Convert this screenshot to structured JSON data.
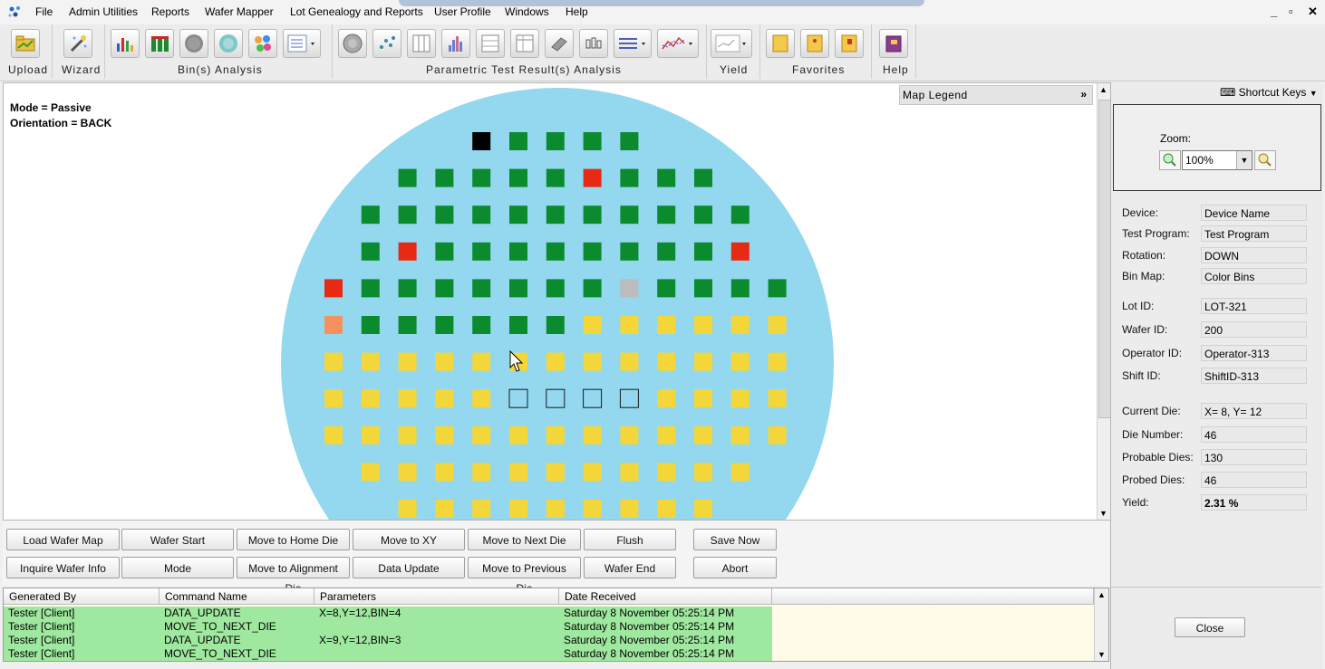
{
  "menu": [
    "File",
    "Admin Utilities",
    "Reports",
    "Wafer Mapper",
    "Lot Genealogy and Reports",
    "User Profile",
    "Windows",
    "Help"
  ],
  "window_controls": [
    "_",
    "▫",
    "✕"
  ],
  "toolbar_groups": [
    "Upload",
    "Wizard",
    "Bin(s) Analysis",
    "Parametric Test Result(s) Analysis",
    "Yield",
    "Favorites",
    "Help"
  ],
  "map": {
    "mode_text": "Mode = Passive",
    "orientation_text": "Orientation = BACK",
    "legend_label": "Map Legend"
  },
  "colors": {
    "wafer": "#93d8ee",
    "pass": "#0b8a2e",
    "fail": "#e62a14",
    "orange": "#f6905d",
    "yellow": "#f3d63a",
    "gray": "#bcbcbc",
    "black": "#000000",
    "log_row": "#9fe89f"
  },
  "dies": [
    {
      "x": 4,
      "y": 0,
      "status": "black"
    },
    {
      "x": 5,
      "y": 0,
      "status": "pass"
    },
    {
      "x": 6,
      "y": 0,
      "status": "pass"
    },
    {
      "x": 7,
      "y": 0,
      "status": "pass"
    },
    {
      "x": 8,
      "y": 0,
      "status": "pass"
    },
    {
      "x": 2,
      "y": 1,
      "status": "pass"
    },
    {
      "x": 3,
      "y": 1,
      "status": "pass"
    },
    {
      "x": 4,
      "y": 1,
      "status": "pass"
    },
    {
      "x": 5,
      "y": 1,
      "status": "pass"
    },
    {
      "x": 6,
      "y": 1,
      "status": "pass"
    },
    {
      "x": 7,
      "y": 1,
      "status": "fail"
    },
    {
      "x": 8,
      "y": 1,
      "status": "pass"
    },
    {
      "x": 9,
      "y": 1,
      "status": "pass"
    },
    {
      "x": 10,
      "y": 1,
      "status": "pass"
    },
    {
      "x": 1,
      "y": 2,
      "status": "pass"
    },
    {
      "x": 2,
      "y": 2,
      "status": "pass"
    },
    {
      "x": 3,
      "y": 2,
      "status": "pass"
    },
    {
      "x": 4,
      "y": 2,
      "status": "pass"
    },
    {
      "x": 5,
      "y": 2,
      "status": "pass"
    },
    {
      "x": 6,
      "y": 2,
      "status": "pass"
    },
    {
      "x": 7,
      "y": 2,
      "status": "pass"
    },
    {
      "x": 8,
      "y": 2,
      "status": "pass"
    },
    {
      "x": 9,
      "y": 2,
      "status": "pass"
    },
    {
      "x": 10,
      "y": 2,
      "status": "pass"
    },
    {
      "x": 11,
      "y": 2,
      "status": "pass"
    },
    {
      "x": 1,
      "y": 3,
      "status": "pass"
    },
    {
      "x": 2,
      "y": 3,
      "status": "fail"
    },
    {
      "x": 3,
      "y": 3,
      "status": "pass"
    },
    {
      "x": 4,
      "y": 3,
      "status": "pass"
    },
    {
      "x": 5,
      "y": 3,
      "status": "pass"
    },
    {
      "x": 6,
      "y": 3,
      "status": "pass"
    },
    {
      "x": 7,
      "y": 3,
      "status": "pass"
    },
    {
      "x": 8,
      "y": 3,
      "status": "pass"
    },
    {
      "x": 9,
      "y": 3,
      "status": "pass"
    },
    {
      "x": 10,
      "y": 3,
      "status": "pass"
    },
    {
      "x": 11,
      "y": 3,
      "status": "fail"
    },
    {
      "x": 0,
      "y": 4,
      "status": "fail"
    },
    {
      "x": 1,
      "y": 4,
      "status": "pass"
    },
    {
      "x": 2,
      "y": 4,
      "status": "pass"
    },
    {
      "x": 3,
      "y": 4,
      "status": "pass"
    },
    {
      "x": 4,
      "y": 4,
      "status": "pass"
    },
    {
      "x": 5,
      "y": 4,
      "status": "pass"
    },
    {
      "x": 6,
      "y": 4,
      "status": "pass"
    },
    {
      "x": 7,
      "y": 4,
      "status": "pass"
    },
    {
      "x": 8,
      "y": 4,
      "status": "gray"
    },
    {
      "x": 9,
      "y": 4,
      "status": "pass"
    },
    {
      "x": 10,
      "y": 4,
      "status": "pass"
    },
    {
      "x": 11,
      "y": 4,
      "status": "pass"
    },
    {
      "x": 12,
      "y": 4,
      "status": "pass"
    },
    {
      "x": 0,
      "y": 5,
      "status": "orange"
    },
    {
      "x": 1,
      "y": 5,
      "status": "pass"
    },
    {
      "x": 2,
      "y": 5,
      "status": "pass"
    },
    {
      "x": 3,
      "y": 5,
      "status": "pass"
    },
    {
      "x": 4,
      "y": 5,
      "status": "pass"
    },
    {
      "x": 5,
      "y": 5,
      "status": "pass"
    },
    {
      "x": 6,
      "y": 5,
      "status": "pass"
    },
    {
      "x": 7,
      "y": 5,
      "status": "yellow"
    },
    {
      "x": 8,
      "y": 5,
      "status": "yellow"
    },
    {
      "x": 9,
      "y": 5,
      "status": "yellow"
    },
    {
      "x": 10,
      "y": 5,
      "status": "yellow"
    },
    {
      "x": 11,
      "y": 5,
      "status": "yellow"
    },
    {
      "x": 12,
      "y": 5,
      "status": "yellow"
    },
    {
      "x": 0,
      "y": 6,
      "status": "yellow"
    },
    {
      "x": 1,
      "y": 6,
      "status": "yellow"
    },
    {
      "x": 2,
      "y": 6,
      "status": "yellow"
    },
    {
      "x": 3,
      "y": 6,
      "status": "yellow"
    },
    {
      "x": 4,
      "y": 6,
      "status": "yellow"
    },
    {
      "x": 5,
      "y": 6,
      "status": "yellow"
    },
    {
      "x": 6,
      "y": 6,
      "status": "yellow"
    },
    {
      "x": 7,
      "y": 6,
      "status": "yellow"
    },
    {
      "x": 8,
      "y": 6,
      "status": "yellow"
    },
    {
      "x": 9,
      "y": 6,
      "status": "yellow"
    },
    {
      "x": 10,
      "y": 6,
      "status": "yellow"
    },
    {
      "x": 11,
      "y": 6,
      "status": "yellow"
    },
    {
      "x": 12,
      "y": 6,
      "status": "yellow"
    },
    {
      "x": 0,
      "y": 7,
      "status": "yellow"
    },
    {
      "x": 1,
      "y": 7,
      "status": "yellow"
    },
    {
      "x": 2,
      "y": 7,
      "status": "yellow"
    },
    {
      "x": 3,
      "y": 7,
      "status": "yellow"
    },
    {
      "x": 4,
      "y": 7,
      "status": "yellow"
    },
    {
      "x": 5,
      "y": 7,
      "status": "empty"
    },
    {
      "x": 6,
      "y": 7,
      "status": "empty"
    },
    {
      "x": 7,
      "y": 7,
      "status": "empty"
    },
    {
      "x": 8,
      "y": 7,
      "status": "empty"
    },
    {
      "x": 9,
      "y": 7,
      "status": "yellow"
    },
    {
      "x": 10,
      "y": 7,
      "status": "yellow"
    },
    {
      "x": 11,
      "y": 7,
      "status": "yellow"
    },
    {
      "x": 12,
      "y": 7,
      "status": "yellow"
    },
    {
      "x": 0,
      "y": 8,
      "status": "yellow"
    },
    {
      "x": 1,
      "y": 8,
      "status": "yellow"
    },
    {
      "x": 2,
      "y": 8,
      "status": "yellow"
    },
    {
      "x": 3,
      "y": 8,
      "status": "yellow"
    },
    {
      "x": 4,
      "y": 8,
      "status": "yellow"
    },
    {
      "x": 5,
      "y": 8,
      "status": "yellow"
    },
    {
      "x": 6,
      "y": 8,
      "status": "yellow"
    },
    {
      "x": 7,
      "y": 8,
      "status": "yellow"
    },
    {
      "x": 8,
      "y": 8,
      "status": "yellow"
    },
    {
      "x": 9,
      "y": 8,
      "status": "yellow"
    },
    {
      "x": 10,
      "y": 8,
      "status": "yellow"
    },
    {
      "x": 11,
      "y": 8,
      "status": "yellow"
    },
    {
      "x": 12,
      "y": 8,
      "status": "yellow"
    },
    {
      "x": 1,
      "y": 9,
      "status": "yellow"
    },
    {
      "x": 2,
      "y": 9,
      "status": "yellow"
    },
    {
      "x": 3,
      "y": 9,
      "status": "yellow"
    },
    {
      "x": 4,
      "y": 9,
      "status": "yellow"
    },
    {
      "x": 5,
      "y": 9,
      "status": "yellow"
    },
    {
      "x": 6,
      "y": 9,
      "status": "yellow"
    },
    {
      "x": 7,
      "y": 9,
      "status": "yellow"
    },
    {
      "x": 8,
      "y": 9,
      "status": "yellow"
    },
    {
      "x": 9,
      "y": 9,
      "status": "yellow"
    },
    {
      "x": 10,
      "y": 9,
      "status": "yellow"
    },
    {
      "x": 11,
      "y": 9,
      "status": "yellow"
    },
    {
      "x": 2,
      "y": 10,
      "status": "yellow"
    },
    {
      "x": 3,
      "y": 10,
      "status": "yellow"
    },
    {
      "x": 4,
      "y": 10,
      "status": "yellow"
    },
    {
      "x": 5,
      "y": 10,
      "status": "yellow"
    },
    {
      "x": 6,
      "y": 10,
      "status": "yellow"
    },
    {
      "x": 7,
      "y": 10,
      "status": "yellow"
    },
    {
      "x": 8,
      "y": 10,
      "status": "yellow"
    },
    {
      "x": 9,
      "y": 10,
      "status": "yellow"
    },
    {
      "x": 10,
      "y": 10,
      "status": "yellow"
    }
  ],
  "actions": {
    "row1": [
      "Load Wafer Map",
      "Wafer Start",
      "Move to Home Die",
      "Move to XY",
      "Move to Next Die",
      "Flush"
    ],
    "row2": [
      "Inquire Wafer Info",
      "Mode",
      "Move to Alignment Die",
      "Data Update",
      "Move to Previous Die",
      "Wafer End"
    ],
    "save": "Save Now",
    "abort": "Abort"
  },
  "log": {
    "headers": [
      "Generated By",
      "Command Name",
      "Parameters",
      "Date Received"
    ],
    "rows": [
      [
        "Tester [Client]",
        "DATA_UPDATE",
        "X=8,Y=12,BIN=4",
        "Saturday 8 November 05:25:14 PM"
      ],
      [
        "Tester [Client]",
        "MOVE_TO_NEXT_DIE",
        "",
        "Saturday 8 November 05:25:14 PM"
      ],
      [
        "Tester [Client]",
        "DATA_UPDATE",
        "X=9,Y=12,BIN=3",
        "Saturday 8 November 05:25:14 PM"
      ],
      [
        "Tester [Client]",
        "MOVE_TO_NEXT_DIE",
        "",
        "Saturday 8 November 05:25:14 PM"
      ]
    ]
  },
  "right_panel": {
    "shortcut_keys": "Shortcut Keys",
    "zoom_label": "Zoom:",
    "zoom_value": "100%",
    "info": [
      {
        "label": "Device:",
        "value": "Device Name"
      },
      {
        "label": "Test Program:",
        "value": "Test Program"
      },
      {
        "label": "Rotation:",
        "value": "DOWN"
      },
      {
        "label": "Bin Map:",
        "value": "Color Bins"
      },
      {
        "label": "Lot ID:",
        "value": "LOT-321"
      },
      {
        "label": "Wafer ID:",
        "value": "200"
      },
      {
        "label": "Operator ID:",
        "value": "Operator-313"
      },
      {
        "label": "Shift ID:",
        "value": "ShiftID-313"
      },
      {
        "label": "Current Die:",
        "value": "X= 8, Y= 12"
      },
      {
        "label": "Die Number:",
        "value": "46"
      },
      {
        "label": "Probable Dies:",
        "value": "130"
      },
      {
        "label": "Probed Dies:",
        "value": "46"
      },
      {
        "label": "Yield:",
        "value": "2.31 %"
      }
    ],
    "close_label": "Close"
  }
}
